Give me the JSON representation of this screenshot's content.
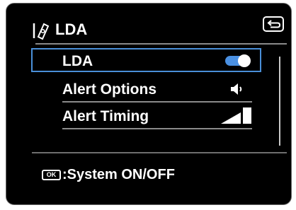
{
  "header": {
    "title": "LDA",
    "icon": "lda-hand-icon",
    "back_icon": "return-icon"
  },
  "menu": {
    "items": [
      {
        "label": "LDA",
        "control": "toggle",
        "state": "on",
        "selected": true
      },
      {
        "label": "Alert Options",
        "control": "speaker-icon"
      },
      {
        "label": "Alert  Timing",
        "control": "timing-level-icon"
      }
    ]
  },
  "footer": {
    "ok_badge": "OK",
    "hint": ":System ON/OFF"
  },
  "colors": {
    "background": "#000000",
    "text": "#ffffff",
    "selection_border": "#4a8fd8",
    "toggle_on": "#4a90e2",
    "divider": "#8a8a8a"
  }
}
